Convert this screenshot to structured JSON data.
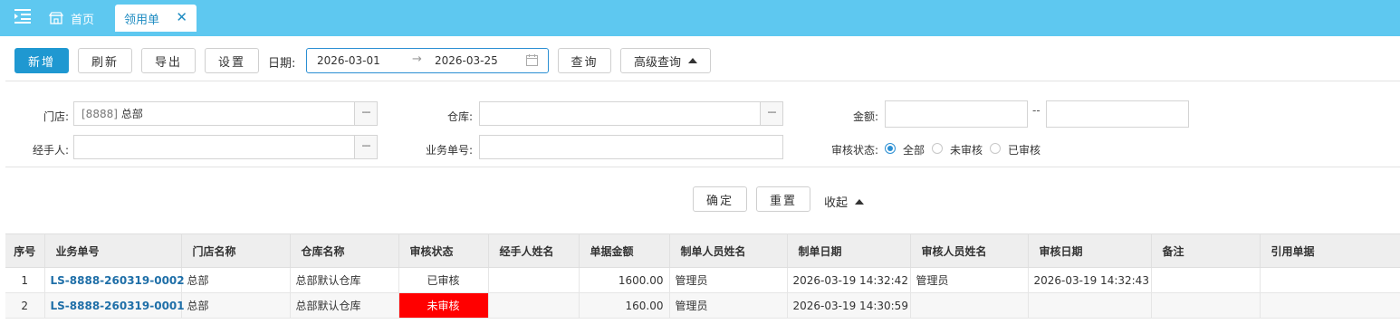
{
  "tabs": {
    "home_label": "首页",
    "active_label": "领用单",
    "close_glyph": "✕"
  },
  "toolbar": {
    "add_label": "新增",
    "refresh_label": "刷新",
    "export_label": "导出",
    "settings_label": "设置",
    "date_label": "日期:",
    "date_from": "2026-03-01",
    "date_arrow": "→",
    "date_to": "2026-03-25",
    "query_label": "查询",
    "advanced_label": "高级查询"
  },
  "filters": {
    "store_label": "门店:",
    "store_code": "[8888]",
    "store_name": "总部",
    "warehouse_label": "仓库:",
    "warehouse_value": "",
    "amount_label": "金额:",
    "amount_min": "",
    "amount_sep": "--",
    "amount_max": "",
    "handler_label": "经手人:",
    "handler_value": "",
    "doc_no_label": "业务单号:",
    "doc_no_value": "",
    "audit_label": "审核状态:",
    "audit_options": [
      "全部",
      "未审核",
      "已审核"
    ],
    "audit_selected": "全部",
    "picker_glyph": "---"
  },
  "actions": {
    "confirm_label": "确定",
    "reset_label": "重置",
    "collapse_label": "收起"
  },
  "table": {
    "headers": [
      "序号",
      "业务单号",
      "门店名称",
      "仓库名称",
      "审核状态",
      "经手人姓名",
      "单据金额",
      "制单人员姓名",
      "制单日期",
      "审核人员姓名",
      "审核日期",
      "备注",
      "引用单据"
    ],
    "rows": [
      [
        "1",
        "LS-8888-260319-0002",
        "总部",
        "总部默认仓库",
        "已审核",
        "",
        "1600.00",
        "管理员",
        "2026-03-19 14:32:42",
        "管理员",
        "2026-03-19 14:32:43",
        "",
        ""
      ],
      [
        "2",
        "LS-8888-260319-0001",
        "总部",
        "总部默认仓库",
        "未审核",
        "",
        "160.00",
        "管理员",
        "2026-03-19 14:30:59",
        "",
        "",
        "",
        ""
      ]
    ]
  },
  "colors": {
    "topbar": "#5ec8f0",
    "primary": "#1f98d1",
    "unaudited_bg": "#ff0000",
    "link": "#1f6fa8"
  }
}
